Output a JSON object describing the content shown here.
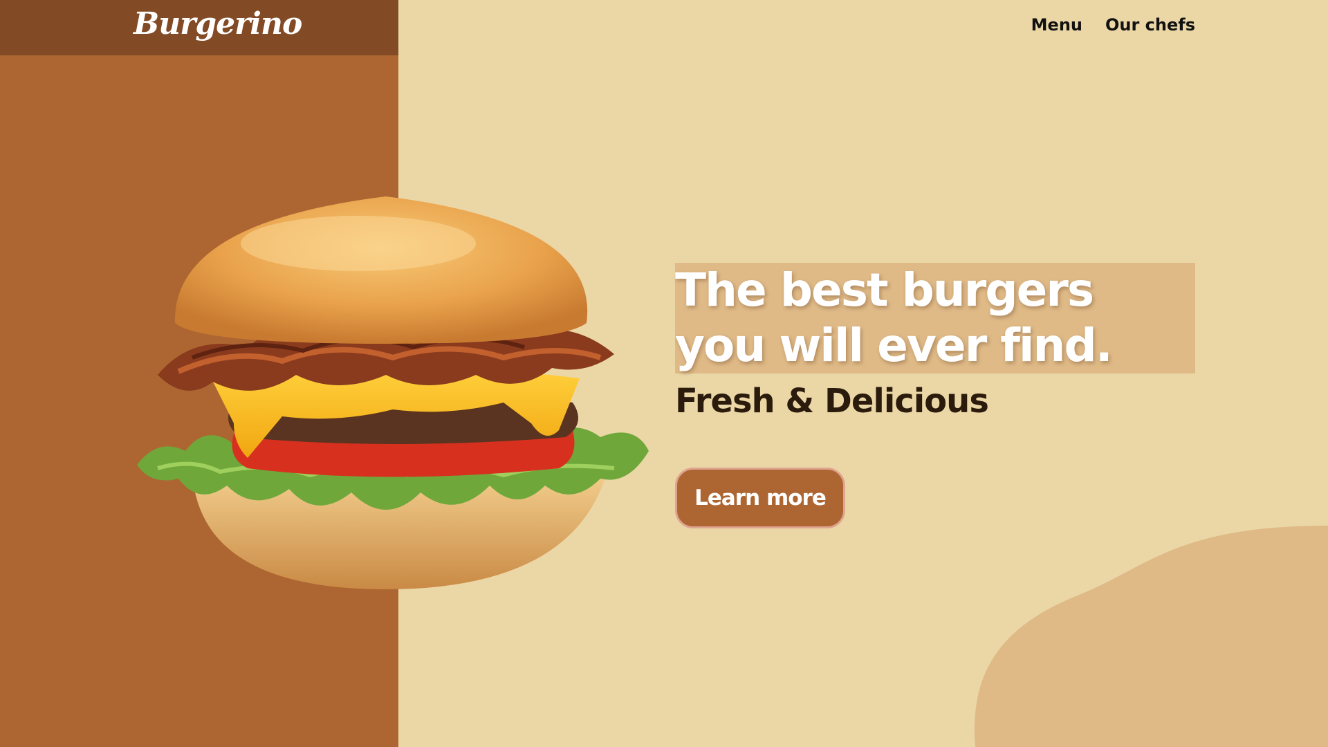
{
  "brand": {
    "logo_text": "Burgerino"
  },
  "nav": {
    "items": [
      {
        "label": "Menu"
      },
      {
        "label": "Our chefs"
      }
    ]
  },
  "hero": {
    "headline": "The best burgers you will ever find.",
    "subheadline": "Fresh & Delicious",
    "cta_label": "Learn more",
    "image_subject": "bacon-cheeseburger-image"
  },
  "colors": {
    "page_background": "#ebd7a6",
    "left_panel": "#ad6631",
    "header_bar": "#834b25",
    "headline_highlight": "#dfba87",
    "decorative_blob": "#dfba87",
    "button": "#ad6631",
    "button_border": "#dfa590",
    "subheadline_text": "#2b1b0c"
  }
}
